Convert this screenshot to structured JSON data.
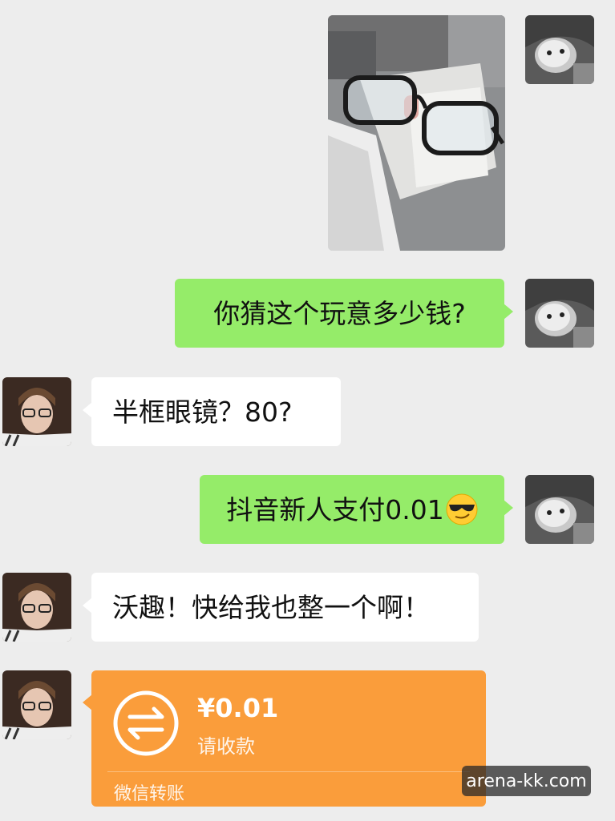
{
  "chat": {
    "messages": [
      {
        "sender": "me",
        "type": "image",
        "image": "glasses-photo"
      },
      {
        "sender": "me",
        "type": "text",
        "text": "你猜这个玩意多少钱?"
      },
      {
        "sender": "friend",
        "type": "text",
        "text": "半框眼镜？80?"
      },
      {
        "sender": "me",
        "type": "text",
        "text": "抖音新人支付0.01",
        "emoji": "sunglasses-emoji"
      },
      {
        "sender": "friend",
        "type": "text",
        "text": "沃趣！快给我也整一个啊！"
      },
      {
        "sender": "friend",
        "type": "transfer",
        "amount": "¥0.01",
        "status": "请收款",
        "brand": "微信转账"
      }
    ]
  },
  "watermark": "arena-kk.com",
  "colors": {
    "background": "#ededed",
    "my_bubble": "#95ec69",
    "friend_bubble": "#ffffff",
    "transfer": "#fa9d3b"
  }
}
